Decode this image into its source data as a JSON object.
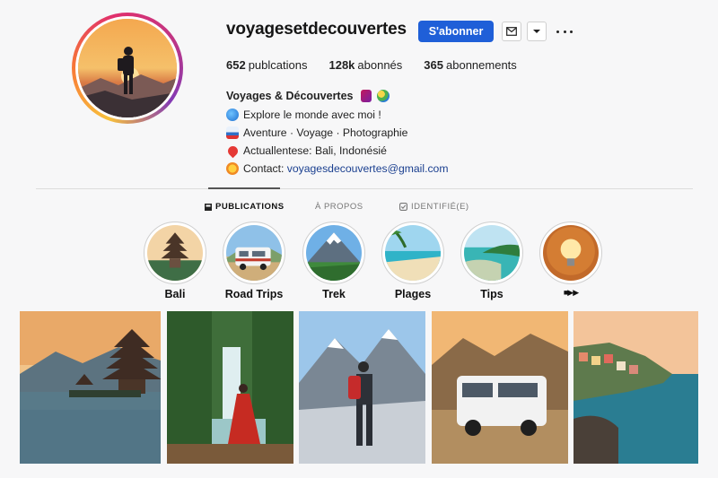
{
  "profile": {
    "username": "voyagesetdecouvertes",
    "follow_label": "S'abonner",
    "stats": [
      {
        "value": "652",
        "label": "publcations"
      },
      {
        "value": "128k",
        "label": "abonnés"
      },
      {
        "value": "365",
        "label": "abonnements"
      }
    ]
  },
  "bio": {
    "name": "Voyages & Découvertes",
    "lines": [
      {
        "icon": "plane-icon",
        "text": "Explore le monde avec moi !"
      },
      {
        "icon": "ship-icon",
        "text": "Aventure · Voyage · Photographie"
      },
      {
        "icon": "location-pin-icon",
        "text": "Actuallentese: Bali, Indonésié"
      },
      {
        "icon": "sun-icon",
        "text": "Contact:",
        "link": "voyagesdecouvertes@gmail.com"
      }
    ]
  },
  "tabs": [
    {
      "label": "PUBLICATIONS",
      "icon": "grid-icon",
      "active": true
    },
    {
      "label": "À PROPOS",
      "icon": "",
      "active": false
    },
    {
      "label": "IDENTIFIÉ(E)",
      "icon": "tag-icon",
      "active": false
    }
  ],
  "highlights": [
    {
      "label": "Bali"
    },
    {
      "label": "Road Trips"
    },
    {
      "label": "Trek"
    },
    {
      "label": "Plages"
    },
    {
      "label": "Tips"
    },
    {
      "label": "■▶▶"
    }
  ],
  "colors": {
    "accent": "#1f5fd8",
    "link": "#1a3f8f"
  }
}
